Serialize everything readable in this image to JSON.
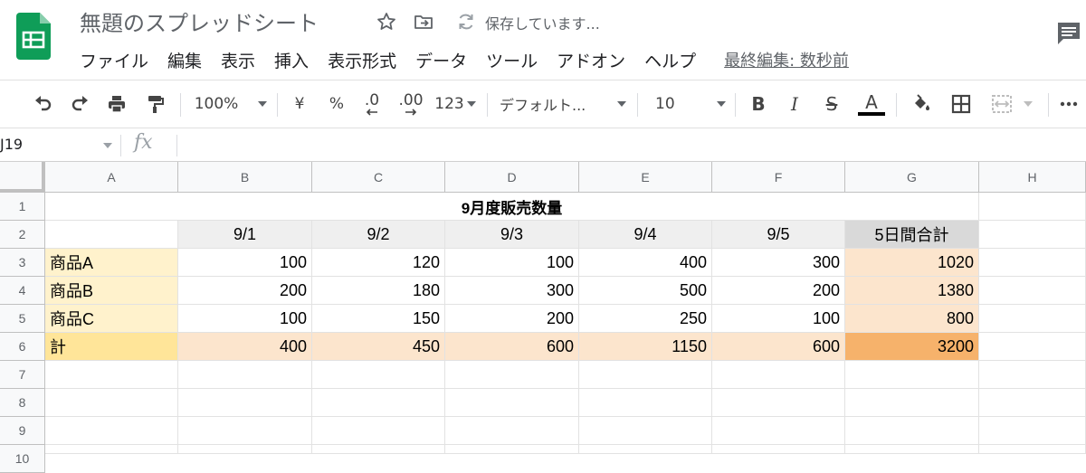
{
  "app": {
    "doc_title": "無題のスプレッドシート",
    "save_status": "保存しています...",
    "last_edit": "最終編集: 数秒前",
    "accent_color": "#0f9d58"
  },
  "menu": [
    "ファイル",
    "編集",
    "表示",
    "挿入",
    "表示形式",
    "データ",
    "ツール",
    "アドオン",
    "ヘルプ"
  ],
  "toolbar": {
    "zoom": "100%",
    "currency": "¥",
    "percent": "%",
    "decrease_decimals": ".0",
    "increase_decimals": ".00",
    "more_formats": "123",
    "font": "デフォルト...",
    "font_size": "10",
    "bold": "B",
    "italic": "I",
    "strikethrough": "S",
    "text_color": "A"
  },
  "formula_bar": {
    "name_box": "J19",
    "fx": "fx",
    "formula": ""
  },
  "sheet": {
    "columns": [
      "A",
      "B",
      "C",
      "D",
      "E",
      "F",
      "G",
      "H"
    ],
    "rows": [
      "1",
      "2",
      "3",
      "4",
      "5",
      "6",
      "7",
      "8",
      "9",
      "10"
    ],
    "title": "9月度販売数量",
    "header_row": [
      "",
      "9/1",
      "9/2",
      "9/3",
      "9/4",
      "9/5",
      "5日間合計"
    ],
    "data_rows": [
      [
        "商品A",
        "100",
        "120",
        "100",
        "400",
        "300",
        "1020"
      ],
      [
        "商品B",
        "200",
        "180",
        "300",
        "500",
        "200",
        "1380"
      ],
      [
        "商品C",
        "100",
        "150",
        "200",
        "250",
        "100",
        "800"
      ],
      [
        "計",
        "400",
        "450",
        "600",
        "1150",
        "600",
        "3200"
      ]
    ],
    "colors": {
      "label_fill": "#fff2cc",
      "total_label_fill": "#ffe599",
      "header_fill": "#efefef",
      "sum_header_fill": "#d9d9d9",
      "sum_col_fill": "#fce5cd",
      "total_row_fill": "#fce5cd",
      "grand_total_fill": "#f6b26b"
    }
  }
}
